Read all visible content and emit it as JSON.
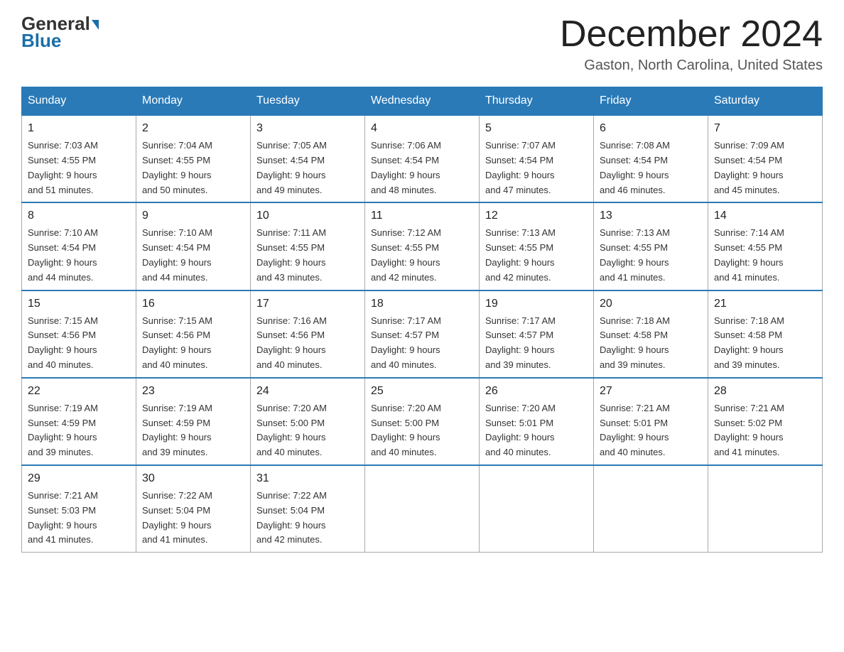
{
  "logo": {
    "general": "General",
    "blue": "Blue"
  },
  "title": "December 2024",
  "subtitle": "Gaston, North Carolina, United States",
  "headers": [
    "Sunday",
    "Monday",
    "Tuesday",
    "Wednesday",
    "Thursday",
    "Friday",
    "Saturday"
  ],
  "weeks": [
    [
      {
        "day": "1",
        "sunrise": "7:03 AM",
        "sunset": "4:55 PM",
        "daylight": "9 hours and 51 minutes."
      },
      {
        "day": "2",
        "sunrise": "7:04 AM",
        "sunset": "4:55 PM",
        "daylight": "9 hours and 50 minutes."
      },
      {
        "day": "3",
        "sunrise": "7:05 AM",
        "sunset": "4:54 PM",
        "daylight": "9 hours and 49 minutes."
      },
      {
        "day": "4",
        "sunrise": "7:06 AM",
        "sunset": "4:54 PM",
        "daylight": "9 hours and 48 minutes."
      },
      {
        "day": "5",
        "sunrise": "7:07 AM",
        "sunset": "4:54 PM",
        "daylight": "9 hours and 47 minutes."
      },
      {
        "day": "6",
        "sunrise": "7:08 AM",
        "sunset": "4:54 PM",
        "daylight": "9 hours and 46 minutes."
      },
      {
        "day": "7",
        "sunrise": "7:09 AM",
        "sunset": "4:54 PM",
        "daylight": "9 hours and 45 minutes."
      }
    ],
    [
      {
        "day": "8",
        "sunrise": "7:10 AM",
        "sunset": "4:54 PM",
        "daylight": "9 hours and 44 minutes."
      },
      {
        "day": "9",
        "sunrise": "7:10 AM",
        "sunset": "4:54 PM",
        "daylight": "9 hours and 44 minutes."
      },
      {
        "day": "10",
        "sunrise": "7:11 AM",
        "sunset": "4:55 PM",
        "daylight": "9 hours and 43 minutes."
      },
      {
        "day": "11",
        "sunrise": "7:12 AM",
        "sunset": "4:55 PM",
        "daylight": "9 hours and 42 minutes."
      },
      {
        "day": "12",
        "sunrise": "7:13 AM",
        "sunset": "4:55 PM",
        "daylight": "9 hours and 42 minutes."
      },
      {
        "day": "13",
        "sunrise": "7:13 AM",
        "sunset": "4:55 PM",
        "daylight": "9 hours and 41 minutes."
      },
      {
        "day": "14",
        "sunrise": "7:14 AM",
        "sunset": "4:55 PM",
        "daylight": "9 hours and 41 minutes."
      }
    ],
    [
      {
        "day": "15",
        "sunrise": "7:15 AM",
        "sunset": "4:56 PM",
        "daylight": "9 hours and 40 minutes."
      },
      {
        "day": "16",
        "sunrise": "7:15 AM",
        "sunset": "4:56 PM",
        "daylight": "9 hours and 40 minutes."
      },
      {
        "day": "17",
        "sunrise": "7:16 AM",
        "sunset": "4:56 PM",
        "daylight": "9 hours and 40 minutes."
      },
      {
        "day": "18",
        "sunrise": "7:17 AM",
        "sunset": "4:57 PM",
        "daylight": "9 hours and 40 minutes."
      },
      {
        "day": "19",
        "sunrise": "7:17 AM",
        "sunset": "4:57 PM",
        "daylight": "9 hours and 39 minutes."
      },
      {
        "day": "20",
        "sunrise": "7:18 AM",
        "sunset": "4:58 PM",
        "daylight": "9 hours and 39 minutes."
      },
      {
        "day": "21",
        "sunrise": "7:18 AM",
        "sunset": "4:58 PM",
        "daylight": "9 hours and 39 minutes."
      }
    ],
    [
      {
        "day": "22",
        "sunrise": "7:19 AM",
        "sunset": "4:59 PM",
        "daylight": "9 hours and 39 minutes."
      },
      {
        "day": "23",
        "sunrise": "7:19 AM",
        "sunset": "4:59 PM",
        "daylight": "9 hours and 39 minutes."
      },
      {
        "day": "24",
        "sunrise": "7:20 AM",
        "sunset": "5:00 PM",
        "daylight": "9 hours and 40 minutes."
      },
      {
        "day": "25",
        "sunrise": "7:20 AM",
        "sunset": "5:00 PM",
        "daylight": "9 hours and 40 minutes."
      },
      {
        "day": "26",
        "sunrise": "7:20 AM",
        "sunset": "5:01 PM",
        "daylight": "9 hours and 40 minutes."
      },
      {
        "day": "27",
        "sunrise": "7:21 AM",
        "sunset": "5:01 PM",
        "daylight": "9 hours and 40 minutes."
      },
      {
        "day": "28",
        "sunrise": "7:21 AM",
        "sunset": "5:02 PM",
        "daylight": "9 hours and 41 minutes."
      }
    ],
    [
      {
        "day": "29",
        "sunrise": "7:21 AM",
        "sunset": "5:03 PM",
        "daylight": "9 hours and 41 minutes."
      },
      {
        "day": "30",
        "sunrise": "7:22 AM",
        "sunset": "5:04 PM",
        "daylight": "9 hours and 41 minutes."
      },
      {
        "day": "31",
        "sunrise": "7:22 AM",
        "sunset": "5:04 PM",
        "daylight": "9 hours and 42 minutes."
      },
      null,
      null,
      null,
      null
    ]
  ],
  "labels": {
    "sunrise": "Sunrise:",
    "sunset": "Sunset:",
    "daylight": "Daylight:"
  }
}
